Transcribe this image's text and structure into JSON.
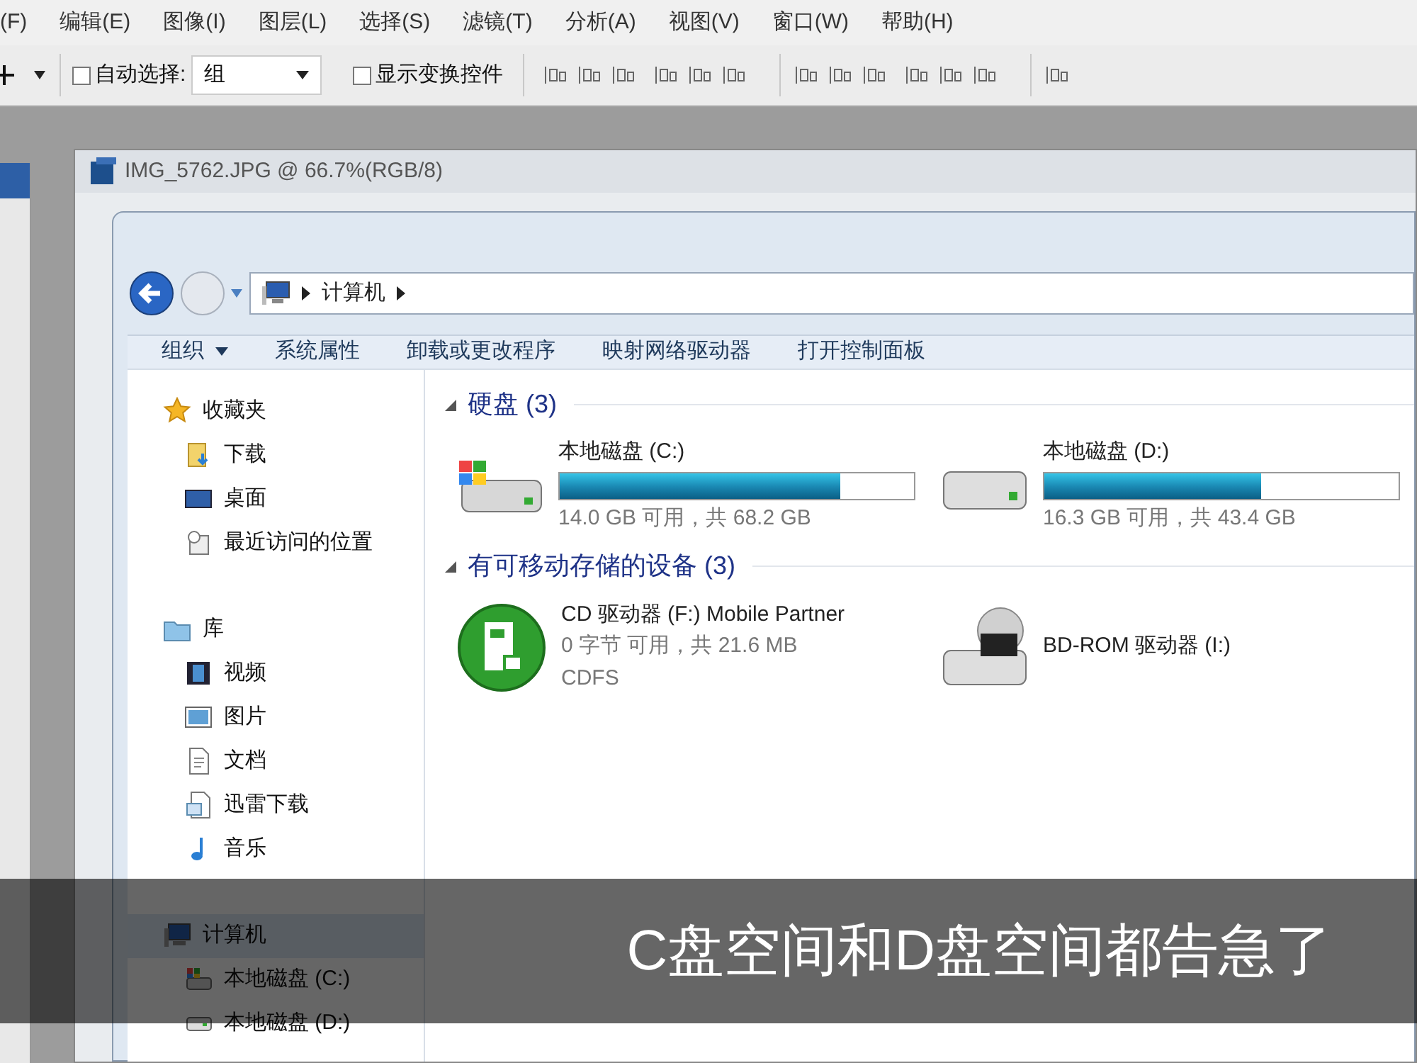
{
  "menu_bar": [
    "(F)",
    "编辑(E)",
    "图像(I)",
    "图层(L)",
    "选择(S)",
    "滤镜(T)",
    "分析(A)",
    "视图(V)",
    "窗口(W)",
    "帮助(H)"
  ],
  "options_bar": {
    "auto_select": {
      "label": "自动选择:",
      "checked": false
    },
    "auto_select_mode": "组",
    "show_transform": {
      "label": "显示变换控件",
      "checked": false
    }
  },
  "document": {
    "title": "IMG_5762.JPG @ 66.7%(RGB/8)"
  },
  "explorer": {
    "address": [
      "计算机"
    ],
    "commands": [
      {
        "label": "组织",
        "dropdown": true
      },
      {
        "label": "系统属性",
        "dropdown": false
      },
      {
        "label": "卸载或更改程序",
        "dropdown": false
      },
      {
        "label": "映射网络驱动器",
        "dropdown": false
      },
      {
        "label": "打开控制面板",
        "dropdown": false
      }
    ],
    "nav": [
      {
        "label": "收藏夹",
        "kind": "star",
        "selected": false,
        "children": [
          {
            "label": "下载",
            "kind": "download",
            "selected": false
          },
          {
            "label": "桌面",
            "kind": "desktop",
            "selected": false
          },
          {
            "label": "最近访问的位置",
            "kind": "recent",
            "selected": false
          }
        ]
      },
      {
        "label": "库",
        "kind": "library",
        "selected": false,
        "children": [
          {
            "label": "视频",
            "kind": "video",
            "selected": false
          },
          {
            "label": "图片",
            "kind": "picture",
            "selected": false
          },
          {
            "label": "文档",
            "kind": "document",
            "selected": false
          },
          {
            "label": "迅雷下载",
            "kind": "download-doc",
            "selected": false
          },
          {
            "label": "音乐",
            "kind": "music",
            "selected": false
          }
        ]
      },
      {
        "label": "计算机",
        "kind": "computer",
        "selected": true,
        "children": [
          {
            "label": "本地磁盘 (C:)",
            "kind": "system-disk",
            "selected": false
          },
          {
            "label": "本地磁盘 (D:)",
            "kind": "disk",
            "selected": false
          }
        ]
      }
    ],
    "sections": [
      {
        "title": "硬盘 (3)",
        "items": [
          {
            "kind": "system-disk",
            "name": "本地磁盘 (C:)",
            "level": 0.79,
            "info": "14.0 GB 可用，共 68.2 GB"
          },
          {
            "kind": "disk",
            "name": "本地磁盘 (D:)",
            "level": 0.61,
            "info": "16.3 GB 可用，共 43.4 GB"
          }
        ]
      },
      {
        "title": "有可移动存储的设备 (3)",
        "items": [
          {
            "kind": "mobile",
            "name": "CD 驱动器 (F:) Mobile Partner",
            "info": "0 字节 可用，共 21.6 MB",
            "fs": "CDFS"
          },
          {
            "kind": "bd",
            "name": "BD-ROM 驱动器 (I:)"
          }
        ]
      }
    ]
  },
  "caption": "C盘空间和D盘空间都告急了"
}
